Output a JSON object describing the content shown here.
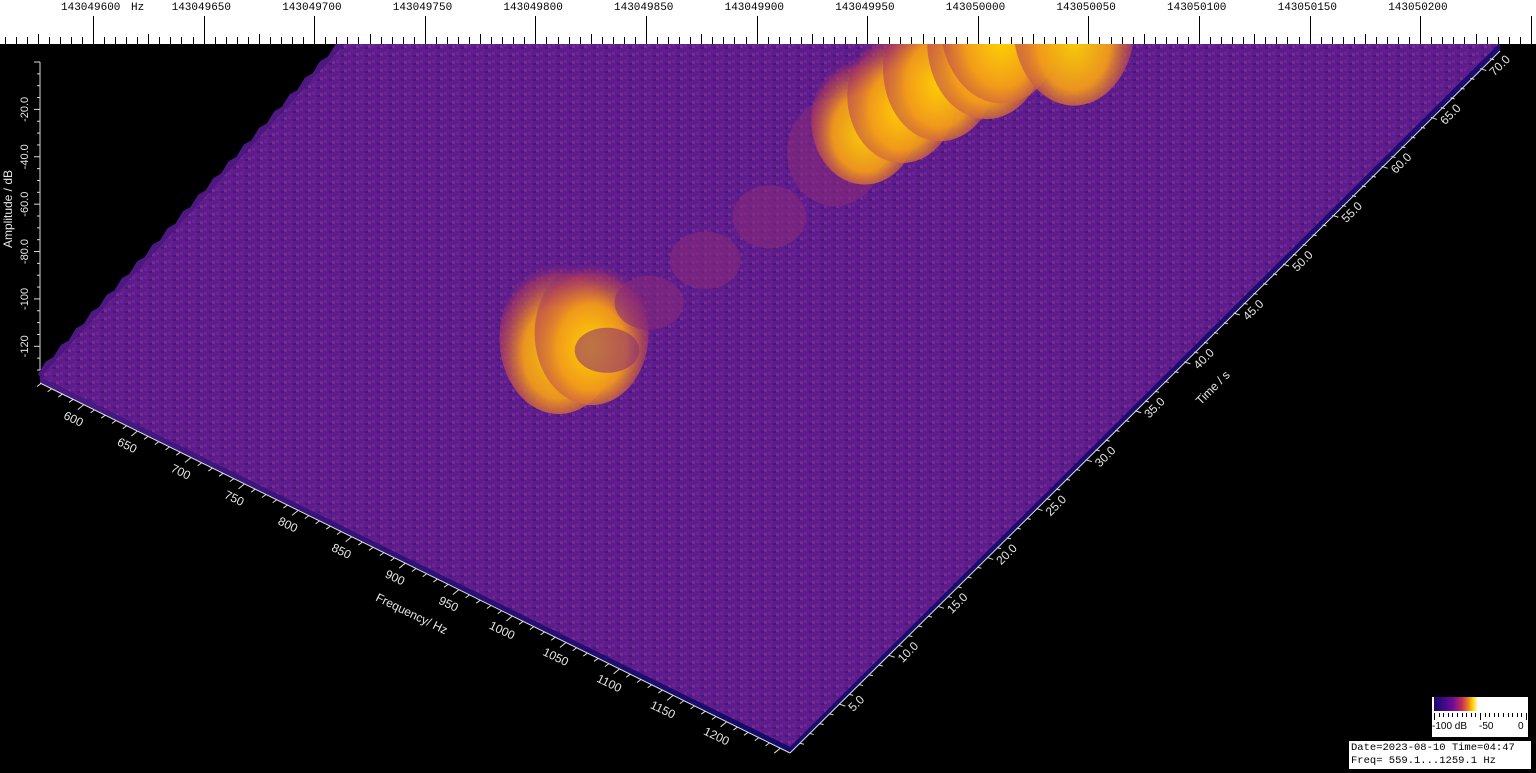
{
  "top_axis": {
    "unit": "Hz",
    "labels": [
      "143049600",
      "143049650",
      "143049700",
      "143049750",
      "143049800",
      "143049850",
      "143049900",
      "143049950",
      "143050000",
      "143050050",
      "143050100",
      "143050150",
      "143050200"
    ]
  },
  "legend": {
    "labels": [
      "-100 dB",
      "-50",
      "0"
    ]
  },
  "info": {
    "date_line": "Date=2023-08-10 Time=04:47",
    "freq_line": "Freq= 559.1...1259.1 Hz"
  },
  "colors": {
    "background": "#000000",
    "noise_floor": "#5a1a8a",
    "low": "#16086e",
    "mid": "#c02a5a",
    "peak": "#ffc400"
  },
  "chart_data": {
    "type": "waterfall-3d",
    "title": "",
    "xlabel": "Frequency/ Hz",
    "ylabel": "Time / s",
    "zlabel": "Amplitude / dB",
    "x_ticks": [
      600,
      650,
      700,
      750,
      800,
      850,
      900,
      950,
      1000,
      1050,
      1100,
      1150,
      1200
    ],
    "y_ticks": [
      "5.0",
      "10.0",
      "15.0",
      "20.0",
      "25.0",
      "30.0",
      "35.0",
      "40.0",
      "45.0",
      "50.0",
      "55.0",
      "60.0",
      "65.0",
      "70.0"
    ],
    "z_ticks": [
      "-20.0",
      "-40.0",
      "-60.0",
      "-80.0",
      "-100",
      "-120"
    ],
    "xlim": [
      559.1,
      1259.1
    ],
    "ylim": [
      0,
      72
    ],
    "zlim": [
      -130,
      0
    ],
    "noise_floor_db": -100,
    "signal_trace": [
      {
        "time": 22,
        "freq": 900,
        "amplitude": -35
      },
      {
        "time": 24,
        "freq": 915,
        "amplitude": -40
      },
      {
        "time": 28,
        "freq": 905,
        "amplitude": -95
      },
      {
        "time": 34,
        "freq": 905,
        "amplitude": -90
      },
      {
        "time": 40,
        "freq": 915,
        "amplitude": -88
      },
      {
        "time": 46,
        "freq": 930,
        "amplitude": -85
      },
      {
        "time": 52,
        "freq": 945,
        "amplitude": -60
      },
      {
        "time": 55,
        "freq": 950,
        "amplitude": -48
      },
      {
        "time": 58,
        "freq": 960,
        "amplitude": -45
      },
      {
        "time": 61,
        "freq": 970,
        "amplitude": -40
      },
      {
        "time": 64,
        "freq": 985,
        "amplitude": -35
      },
      {
        "time": 66,
        "freq": 985,
        "amplitude": -30
      },
      {
        "time": 66,
        "freq": 1030,
        "amplitude": -32
      }
    ]
  }
}
